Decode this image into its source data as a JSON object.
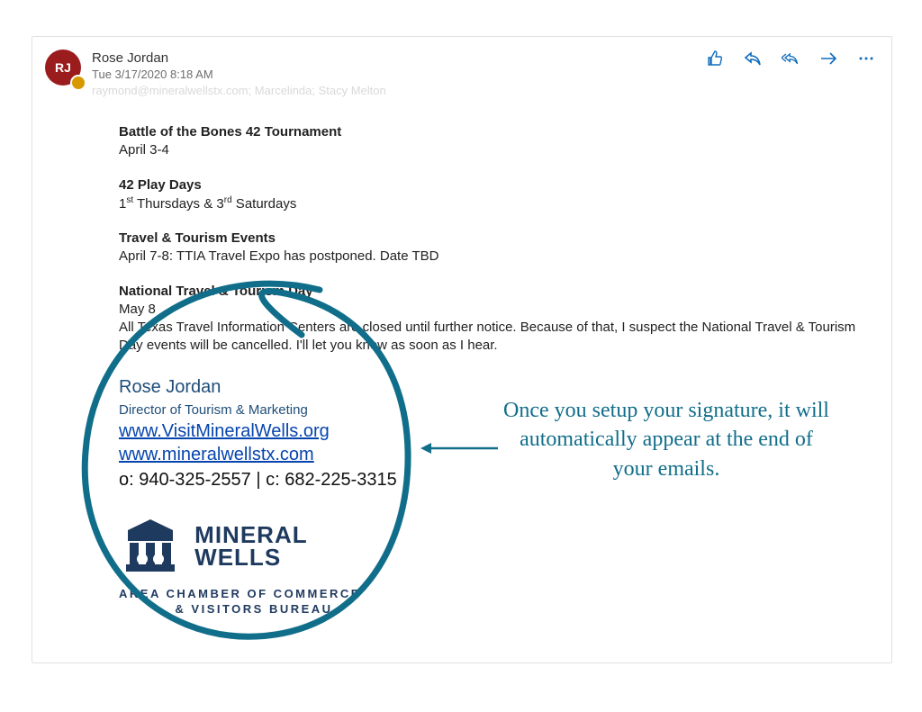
{
  "email": {
    "avatar_initials": "RJ",
    "sender_name": "Rose Jordan",
    "sender_date": "Tue 3/17/2020 8:18 AM",
    "recipients_faded": "raymond@mineralwellstx.com; Marcelinda; Stacy Melton",
    "sections": {
      "s1_title": "Battle of the Bones 42 Tournament",
      "s1_line": "April 3-4",
      "s2_title": "42 Play Days",
      "s2_line_pre1": "1",
      "s2_sup1": "st",
      "s2_mid": " Thursdays & 3",
      "s2_sup2": "rd",
      "s2_post": " Saturdays",
      "s3_title": "Travel & Tourism Events",
      "s3_line": "April 7-8: TTIA Travel Expo has postponed. Date TBD",
      "s4_title": "National Travel & Tourism Day",
      "s4_line1": "May 8",
      "s4_line2": "All Texas Travel Information Centers are closed until further notice. Because of that, I suspect the National Travel & Tourism Day events will be cancelled. I'll let you know as soon as I hear."
    },
    "signature": {
      "name": "Rose Jordan",
      "title": "Director of Tourism & Marketing",
      "link1": "www.VisitMineralWells.org",
      "link2": "www.mineralwellstx.com",
      "phone": "o: 940-325-2557 | c: 682-225-3315",
      "logo_line1": "MINERAL",
      "logo_line2": "WELLS",
      "logo_sub1": "AREA CHAMBER OF COMMERCE",
      "logo_sub2": "& VISITORS BUREAU"
    }
  },
  "annotation": {
    "text": "Once you setup your signature, it will automatically appear at the end of your emails."
  }
}
